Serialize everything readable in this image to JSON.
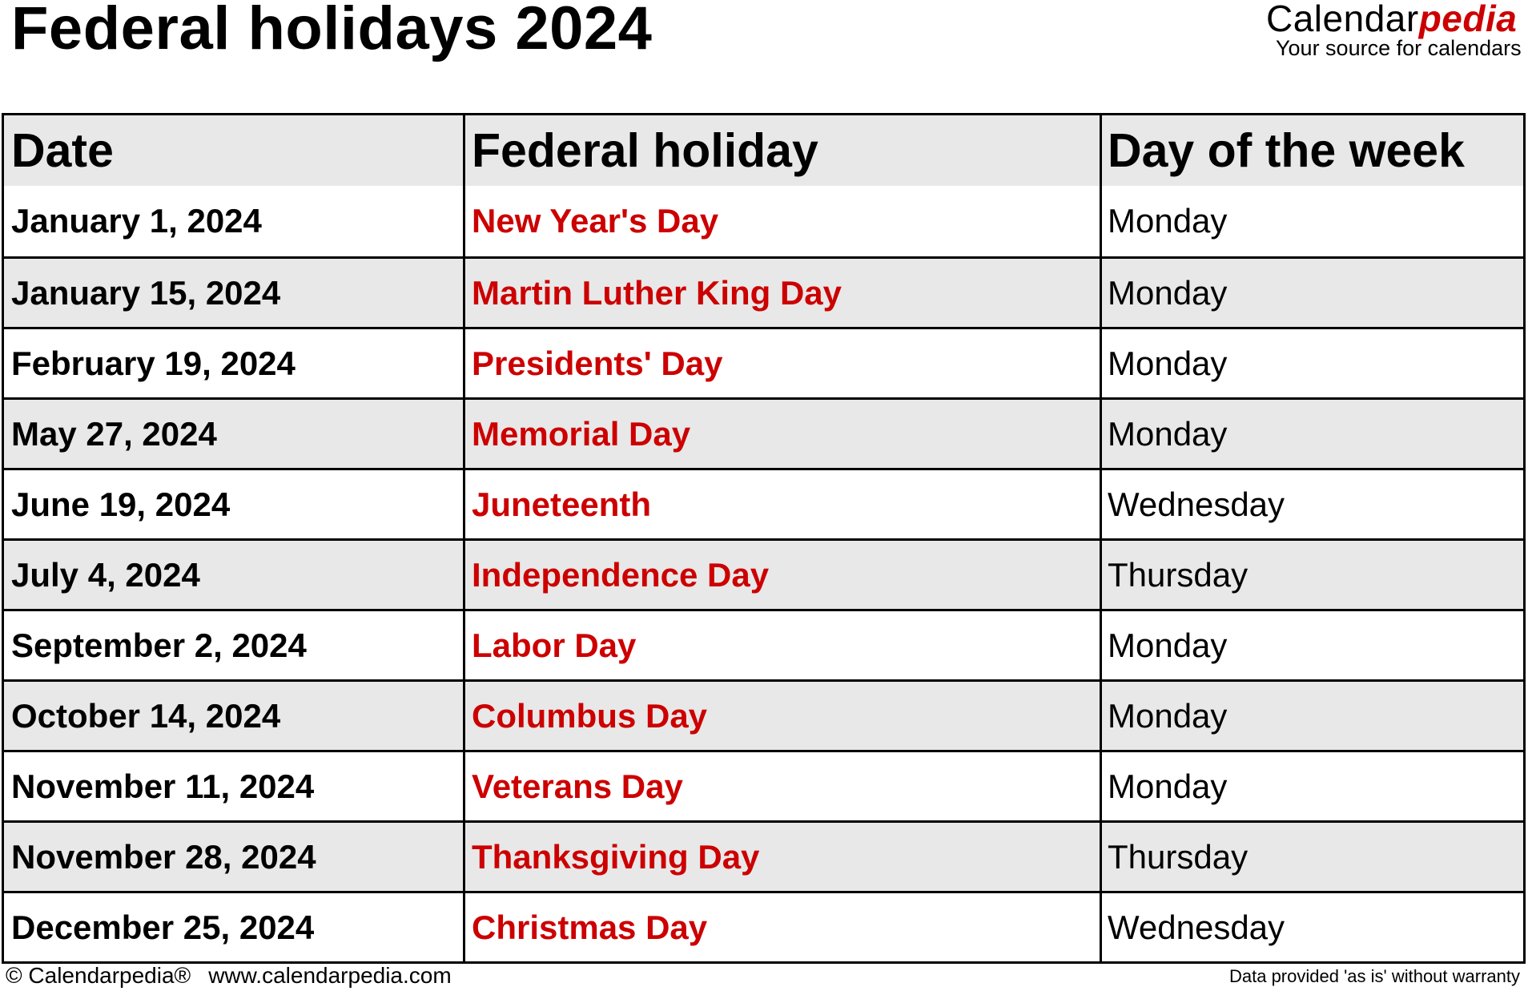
{
  "title": "Federal holidays 2024",
  "logo": {
    "name_part1": "Calendar",
    "name_part2": "pedia",
    "tagline": "Your source for calendars"
  },
  "colors": {
    "holiday_text": "#cc0000",
    "shaded_row": "#e8e8e8",
    "border": "#000000"
  },
  "table": {
    "headers": [
      "Date",
      "Federal holiday",
      "Day of the week"
    ],
    "rows": [
      {
        "date": "January 1, 2024",
        "holiday": "New Year's Day",
        "day": "Monday"
      },
      {
        "date": "January 15, 2024",
        "holiday": "Martin Luther King Day",
        "day": "Monday"
      },
      {
        "date": "February 19, 2024",
        "holiday": "Presidents' Day",
        "day": "Monday"
      },
      {
        "date": "May 27, 2024",
        "holiday": "Memorial Day",
        "day": "Monday"
      },
      {
        "date": "June 19, 2024",
        "holiday": "Juneteenth",
        "day": "Wednesday"
      },
      {
        "date": "July 4, 2024",
        "holiday": "Independence Day",
        "day": "Thursday"
      },
      {
        "date": "September 2, 2024",
        "holiday": "Labor Day",
        "day": "Monday"
      },
      {
        "date": "October 14, 2024",
        "holiday": "Columbus Day",
        "day": "Monday"
      },
      {
        "date": "November 11, 2024",
        "holiday": "Veterans Day",
        "day": "Monday"
      },
      {
        "date": "November 28, 2024",
        "holiday": "Thanksgiving Day",
        "day": "Thursday"
      },
      {
        "date": "December 25, 2024",
        "holiday": "Christmas Day",
        "day": "Wednesday"
      }
    ]
  },
  "footer": {
    "copyright": "© Calendarpedia®",
    "url": "www.calendarpedia.com",
    "disclaimer": "Data provided 'as is' without warranty"
  }
}
